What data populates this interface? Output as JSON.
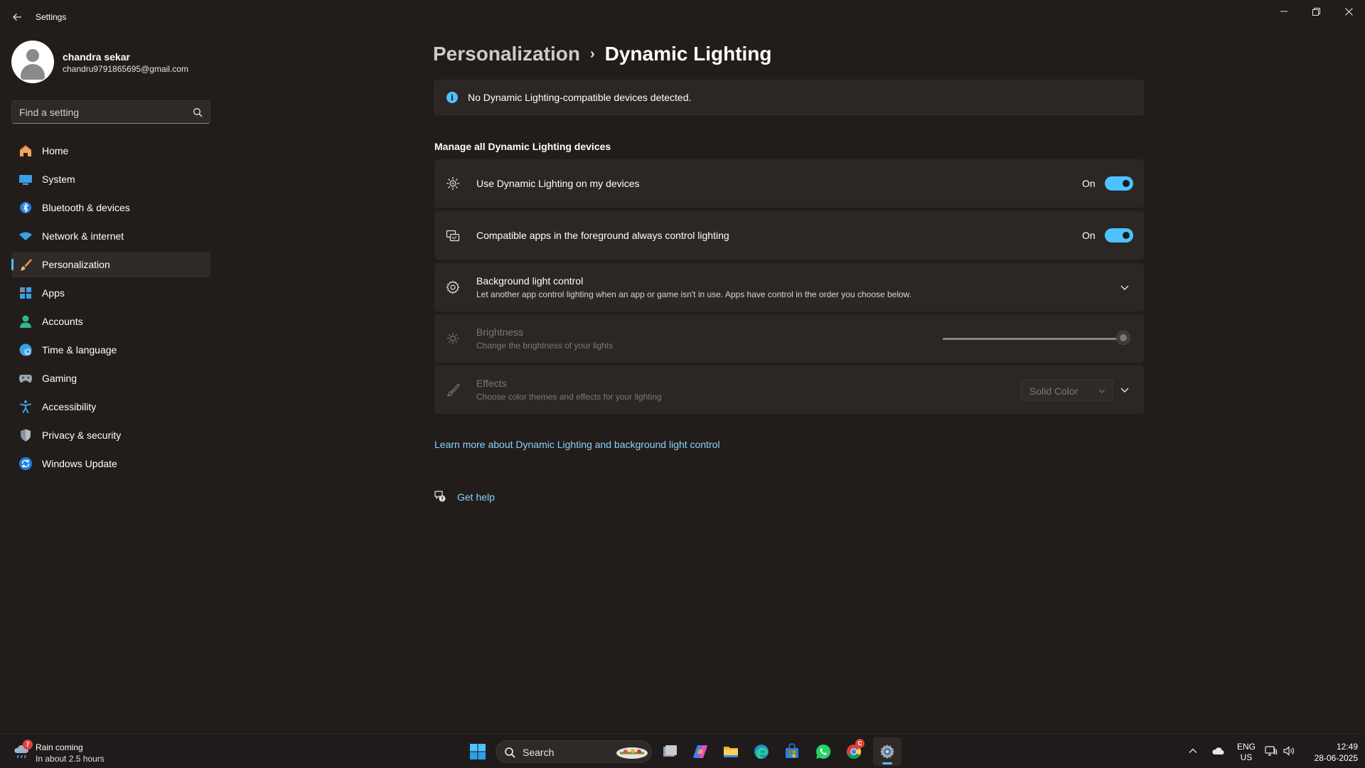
{
  "window": {
    "title": "Settings",
    "back_icon": "arrow-left-icon",
    "controls": [
      "minimize-icon",
      "restore-icon",
      "close-icon"
    ]
  },
  "profile": {
    "name": "chandra sekar",
    "email": "chandru9791865695@gmail.com"
  },
  "search": {
    "placeholder": "Find a setting",
    "value": ""
  },
  "sidebar": {
    "items": [
      {
        "label": "Home",
        "icon": "home-icon"
      },
      {
        "label": "System",
        "icon": "monitor-icon"
      },
      {
        "label": "Bluetooth & devices",
        "icon": "bluetooth-icon"
      },
      {
        "label": "Network & internet",
        "icon": "wifi-icon"
      },
      {
        "label": "Personalization",
        "icon": "brush-icon",
        "active": true
      },
      {
        "label": "Apps",
        "icon": "apps-icon"
      },
      {
        "label": "Accounts",
        "icon": "person-icon"
      },
      {
        "label": "Time & language",
        "icon": "globe-clock-icon"
      },
      {
        "label": "Gaming",
        "icon": "gamepad-icon"
      },
      {
        "label": "Accessibility",
        "icon": "accessibility-icon"
      },
      {
        "label": "Privacy & security",
        "icon": "shield-icon"
      },
      {
        "label": "Windows Update",
        "icon": "refresh-icon"
      }
    ]
  },
  "breadcrumb": {
    "parent": "Personalization",
    "separator": "›",
    "current": "Dynamic Lighting"
  },
  "info": {
    "text": "No Dynamic Lighting-compatible devices detected."
  },
  "section": {
    "title": "Manage all Dynamic Lighting devices"
  },
  "settings": {
    "use_dynamic": {
      "label": "Use Dynamic Lighting on my devices",
      "state": "On",
      "on": true
    },
    "foreground_apps": {
      "label": "Compatible apps in the foreground always control lighting",
      "state": "On",
      "on": true
    },
    "background": {
      "label": "Background light control",
      "desc": "Let another app control lighting when an app or game isn't in use. Apps have control in the order you choose below."
    },
    "brightness": {
      "label": "Brightness",
      "desc": "Change the brightness of your lights",
      "value": 100,
      "enabled": false
    },
    "effects": {
      "label": "Effects",
      "desc": "Choose color themes and effects for your lighting",
      "selected": "Solid Color",
      "enabled": false
    }
  },
  "links": {
    "learn_more": "Learn more about Dynamic Lighting and background light control",
    "get_help": "Get help"
  },
  "taskbar": {
    "weather_title": "Rain coming",
    "weather_sub": "In about 2.5 hours",
    "weather_badge": "7",
    "search_label": "Search",
    "chrome_badge": "C",
    "apps": [
      "windows-start-icon",
      "task-view-icon",
      "copilot-icon",
      "file-explorer-icon",
      "edge-icon",
      "store-icon",
      "whatsapp-icon",
      "chrome-icon",
      "settings-icon"
    ],
    "lang_top": "ENG",
    "lang_bottom": "US",
    "time": "12:49",
    "date": "28-06-2025"
  },
  "colors": {
    "accent": "#4cc2ff",
    "background": "#221d1b",
    "card": "#2c2725",
    "link": "#88d3ff"
  }
}
